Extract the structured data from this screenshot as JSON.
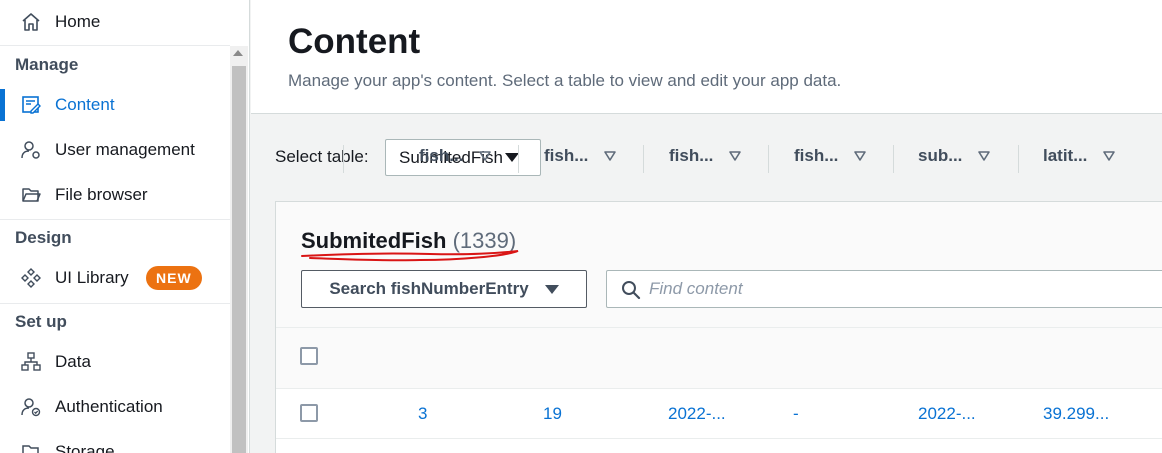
{
  "sidebar": {
    "home": "Home",
    "sections": {
      "manage": "Manage",
      "design": "Design",
      "setup": "Set up"
    },
    "items": {
      "content": "Content",
      "user_management": "User management",
      "file_browser": "File browser",
      "ui_library": "UI Library",
      "ui_library_badge": "NEW",
      "data": "Data",
      "authentication": "Authentication",
      "storage": "Storage"
    }
  },
  "header": {
    "title": "Content",
    "description": "Manage your app's content. Select a table to view and edit your app data."
  },
  "select_table": {
    "label": "Select table:",
    "value": "SubmitedFish"
  },
  "table": {
    "name": "SubmitedFish",
    "count": "(1339)",
    "search_button": "Search fishNumberEntry",
    "find_placeholder": "Find content",
    "columns": [
      "fish...",
      "fish...",
      "fish...",
      "fish...",
      "sub...",
      "latit..."
    ],
    "rows": [
      [
        "3",
        "19",
        "2022-...",
        "-",
        "2022-...",
        "39.299..."
      ]
    ]
  },
  "colors": {
    "accent": "#0972d3",
    "badge": "#ec7211",
    "annotation": "#d91515"
  }
}
